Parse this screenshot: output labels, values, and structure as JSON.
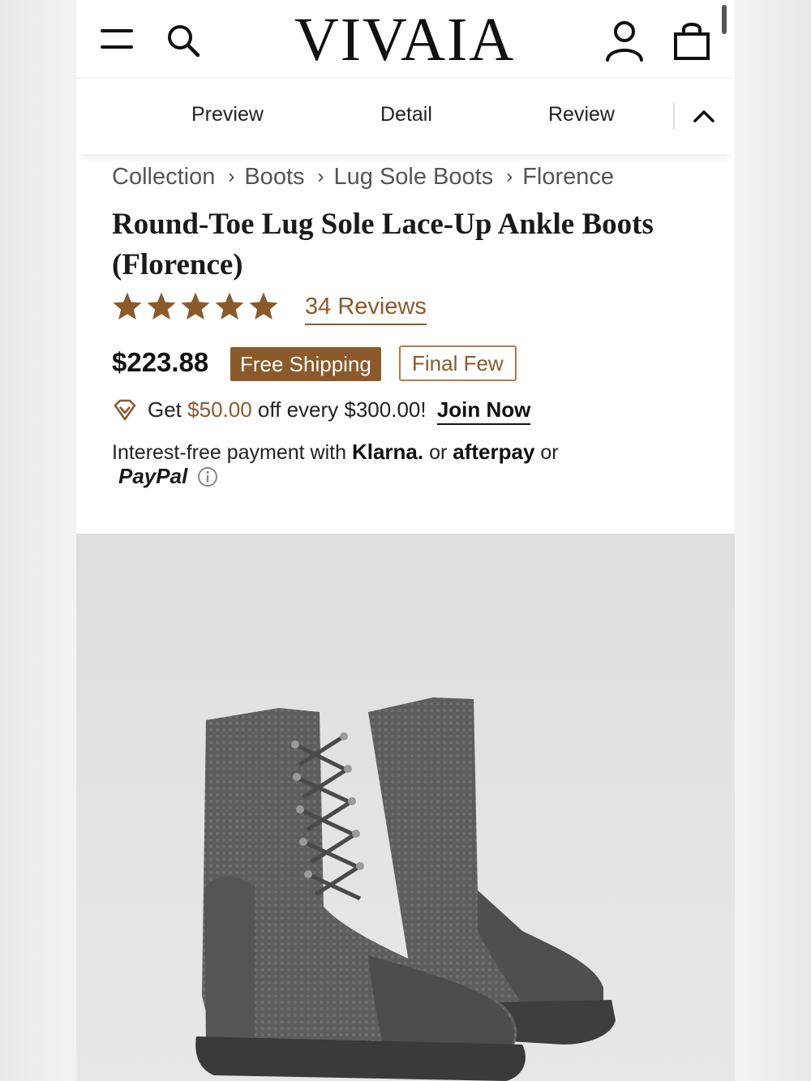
{
  "header": {
    "logo": "VIVAIA",
    "icons": [
      "menu-icon",
      "search-icon",
      "account-icon",
      "bag-icon"
    ]
  },
  "tabs": [
    {
      "label": "Preview"
    },
    {
      "label": "Detail"
    },
    {
      "label": "Review"
    }
  ],
  "breadcrumb": [
    "Collection",
    "Boots",
    "Lug Sole Boots",
    "Florence"
  ],
  "product": {
    "title": "Round-Toe Lug Sole Lace-Up Ankle Boots (Florence)",
    "rating_stars": 5,
    "reviews": "34 Reviews",
    "price": "$223.88",
    "badge_shipping": "Free Shipping",
    "badge_stock": "Final Few"
  },
  "promo": {
    "prefix": "Get",
    "amount": "$50.00",
    "suffix": "off every $300.00!",
    "cta": "Join Now"
  },
  "payment": {
    "prefix": "Interest-free payment with",
    "klarna": "Klarna.",
    "or1": "or",
    "afterpay": "afterpay",
    "or2": "or",
    "paypal": "PayPal"
  },
  "colors": {
    "accent": "#8b5a2b",
    "text": "#1a1a1a",
    "image_bg": "#e2e2e2"
  }
}
